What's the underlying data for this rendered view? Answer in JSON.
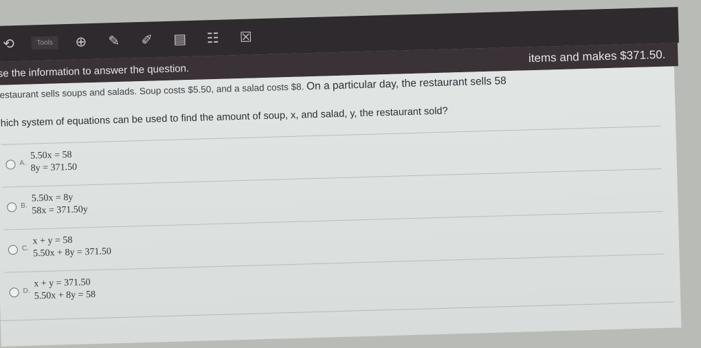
{
  "toolbar": {
    "tool_text": "Tools",
    "icons": [
      "back-icon",
      "zoom-icon",
      "pencil-icon",
      "highlighter-icon",
      "calculator-icon",
      "notes-icon",
      "eliminator-icon"
    ]
  },
  "header": {
    "instruction": "se the information to answer the question.",
    "stem_trailing": "items and makes $371.50."
  },
  "stem": {
    "intro": "estaurant sells soups and salads. Soup costs $5.50, and a salad costs $8. ",
    "middle": "On a particular day, the restaurant sells 58"
  },
  "question": "hich system of equations can be used to find the amount of soup, x, and salad, y, the restaurant sold?",
  "choices": [
    {
      "letter": "A.",
      "eq1": "5.50x = 58",
      "eq2": "8y = 371.50"
    },
    {
      "letter": "B.",
      "eq1": "5.50x = 8y",
      "eq2": "58x = 371.50y"
    },
    {
      "letter": "C.",
      "eq1": "x + y = 58",
      "eq2": "5.50x + 8y = 371.50"
    },
    {
      "letter": "D.",
      "eq1": "x + y = 371.50",
      "eq2": "5.50x + 8y = 58"
    }
  ]
}
